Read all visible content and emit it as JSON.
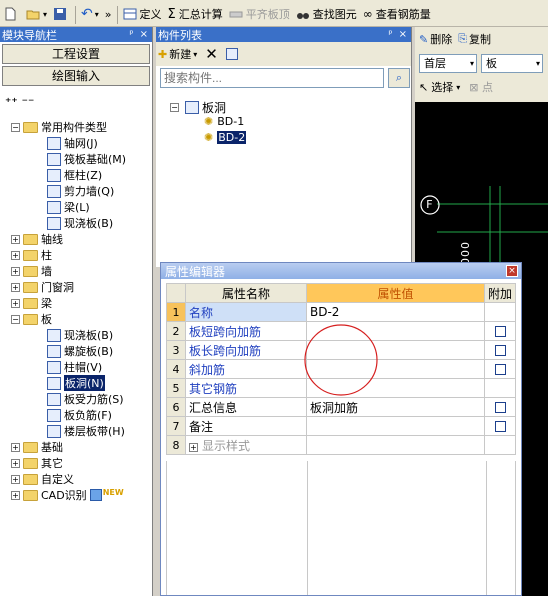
{
  "toolbar": {
    "items": [
      {
        "label": "定义"
      },
      {
        "label": "汇总计算"
      },
      {
        "label": "平齐板顶"
      },
      {
        "label": "查找图元"
      },
      {
        "label": "查看钢筋量"
      }
    ],
    "more": "»"
  },
  "left_nav": {
    "title": "模块导航栏",
    "pin": "ᵖ",
    "close": "×",
    "project_settings": "工程设置",
    "drawing_input": "绘图输入",
    "tree": {
      "root": "常用构件类型",
      "root_children": [
        "轴网(J)",
        "筏板基础(M)",
        "框柱(Z)",
        "剪力墙(Q)",
        "梁(L)",
        "现浇板(B)"
      ],
      "groups": [
        "轴线",
        "柱",
        "墙",
        "门窗洞",
        "梁"
      ],
      "slab_group": "板",
      "slab_children": [
        "现浇板(B)",
        "螺旋板(B)",
        "柱帽(V)",
        "板洞(N)",
        "板受力筋(S)",
        "板负筋(F)",
        "楼层板带(H)"
      ],
      "selected_child": "板洞(N)",
      "after_groups": [
        "基础",
        "其它",
        "自定义"
      ],
      "cad_group": "CAD识别",
      "new_badge": "NEW"
    }
  },
  "component_list": {
    "title": "构件列表",
    "pin": "ᵖ",
    "close": "×",
    "new_label": "新建",
    "search_placeholder": "搜索构件...",
    "tree_root": "板洞",
    "items": [
      "BD-1",
      "BD-2"
    ],
    "selected": "BD-2"
  },
  "right_pane": {
    "delete_label": "删除",
    "copy_label": "复制",
    "floor_value": "首层",
    "type_value": "板",
    "select_label": "选择",
    "canvas_axis_label": "F",
    "canvas_dim_text": "000"
  },
  "property_editor": {
    "title": "属性编辑器",
    "close": "×",
    "headers": {
      "name": "属性名称",
      "value": "属性值",
      "add": "附加"
    },
    "rows": [
      {
        "num": "1",
        "name": "名称",
        "value": "BD-2",
        "checkbox": false
      },
      {
        "num": "2",
        "name": "板短跨向加筋",
        "value": "",
        "checkbox": true
      },
      {
        "num": "3",
        "name": "板长跨向加筋",
        "value": "",
        "checkbox": true
      },
      {
        "num": "4",
        "name": "斜加筋",
        "value": "",
        "checkbox": true
      },
      {
        "num": "5",
        "name": "其它钢筋",
        "value": "",
        "checkbox": false
      },
      {
        "num": "6",
        "name": "汇总信息",
        "value": "板洞加筋",
        "checkbox": true
      },
      {
        "num": "7",
        "name": "备注",
        "value": "",
        "checkbox": true
      },
      {
        "num": "8",
        "name": "显示样式",
        "value": "",
        "checkbox": false
      }
    ],
    "expand_symbol": "+",
    "annotation_color": "#d61f1f"
  },
  "colors": {
    "titlebar": "#3a70c8",
    "canvas": "#000000",
    "grid_green": "#22a84a",
    "selection": "#0a246a"
  }
}
